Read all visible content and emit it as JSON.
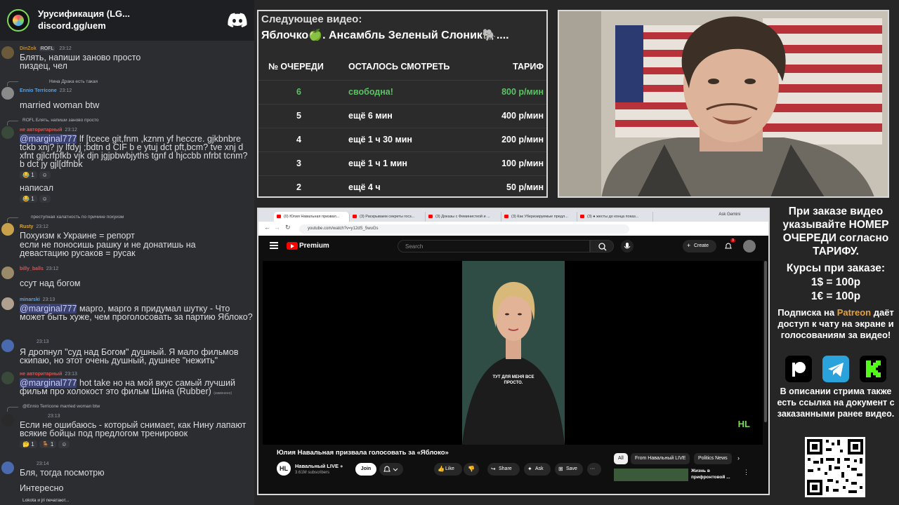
{
  "chat": {
    "server_title": "Урусификация (LG...",
    "server_invite": "discord.gg/uem",
    "messages": [
      {
        "user": "DinZok",
        "tag": "ROFL",
        "time": "23:12",
        "user_color": "#b98b3a",
        "text": "Блять, напиши заново просто\nпиздец, чел"
      },
      {
        "reply": "Нина Драка есть такая",
        "user": "Ennio Terricone",
        "time": "23:12",
        "user_color": "#5aa0e6",
        "text": "married woman btw"
      },
      {
        "reply": "ROFL  Блять, напиши заново просто",
        "user": "не авторитарный",
        "time": "23:12",
        "user_color": "#e05050",
        "mention": "@marginal777",
        "text": " lf [tcece git,fnm ,kznm yf heccre. gjkbnbre tckb xnj? jy lfdyj ;bdtn d CIF b e ytuj dct pft,bcm? tve xnj d xfnt gjlcrfpfkb vjk djn jgjpbwbjyths tgnf d hjccbb nfrbt tcnm? b dct jy gjl[dfnbk",
        "reactions": [
          "1",
          ""
        ]
      },
      {
        "text": "написал",
        "reactions": [
          "1",
          ""
        ]
      },
      {
        "reply": "преступная халатность по причине похуизм",
        "user": "Rusty",
        "time": "23:12",
        "user_color": "#d8a53a",
        "text": "Похуизм к Украине = репорт\nесли не поносишь рашку и не донатишь на\nдевастацию русаков = русак"
      },
      {
        "user": "billy_balls",
        "time": "23:12",
        "user_color": "#e05050",
        "text": "ссут над богом"
      },
      {
        "user": "minarski",
        "time": "23:13",
        "user_color": "#5aa0e6",
        "mention": "@marginal777",
        "text": " марго, марго я придумал шутку - Что может быть хуже, чем проголосовать за партию Яблоко?"
      },
      {
        "time": "23:13",
        "text": "Я дропнул \"суд над Богом\" душный. Я мало фильмов скипаю, но этот очень душный, душнее \"нежить\""
      },
      {
        "user": "не авторитарный",
        "time": "23:13",
        "user_color": "#e05050",
        "mention": "@marginal777",
        "text": " hot take но на мой вкус самый лучший фильм про холокост это фильм Шина (Rubber)",
        "edited": "(изменено)"
      },
      {
        "reply": "@Ennio Terricone  married woman btw",
        "time": "23:13",
        "text": "Если не ошибаюсь - который снимает, как Нину лапают всякие бойцы под предлогом тренировок",
        "reactions": [
          "1",
          "1",
          ""
        ]
      },
      {
        "time": "23:14",
        "text": "Бля, тогда посмотрю"
      },
      {
        "text": "Интересно"
      }
    ],
    "typing": "Lokota и jri печатают..."
  },
  "queue": {
    "next_label": "Следующее видео:",
    "next_title": "Яблочко🍏. Ансамбль Зеленый Слоник🐘....",
    "headers": [
      "№ ОЧЕРЕДИ",
      "ОСТАЛОСЬ СМОТРЕТЬ",
      "ТАРИФ"
    ],
    "rows": [
      {
        "num": "6",
        "left": "свободна!",
        "rate": "800 р/мин",
        "free": true
      },
      {
        "num": "5",
        "left": "ещё 6 мин",
        "rate": "400 р/мин"
      },
      {
        "num": "4",
        "left": "ещё 1 ч 30 мин",
        "rate": "200 р/мин"
      },
      {
        "num": "3",
        "left": "ещё 1 ч 1 мин",
        "rate": "100 р/мин"
      },
      {
        "num": "2",
        "left": "ещё 4 ч",
        "rate": "50 р/мин"
      }
    ]
  },
  "browser": {
    "tabs": [
      "(0) Юлия Навальная призвал...",
      "(3) Раскрываем секреты госз...",
      "(3) Доказы с Феминисткой и ...",
      "(3) Как Уберизируемые предл...",
      "(3) ● жесты до конца показ..."
    ],
    "ask_gemini": "Ask Gemini",
    "url": "youtube.com/watch?v=y12dS_5wuGs",
    "brand": "Premium",
    "search_placeholder": "Search",
    "create": "Create",
    "bell_count": "3",
    "video_caption": "ТУТ ДЛЯ МЕНЯ ВСЕ ПРОСТО.",
    "corner_logo": "HL",
    "video_title": "Юлия Навальная призвала голосовать за «Яблоко»",
    "channel_logo": "HL",
    "channel": "Навальный LIVE",
    "subs": "3.61M subscribers",
    "join": "Join",
    "actions": [
      "Like",
      "",
      "Share",
      "Ask",
      "Save",
      "···"
    ],
    "chips": [
      "All",
      "From Навальный LIVE",
      "Politics News"
    ],
    "side_title": "Жизнь в прифронтовой ..."
  },
  "info": {
    "order_text": "При заказе видео указывайте НОМЕР ОЧЕРЕДИ согласно ТАРИФУ.",
    "rates_title": "Курсы при заказе:",
    "rates": [
      "1$ = 100р",
      "1€ = 100р"
    ],
    "sub_before": "Подписка на ",
    "sub_patreon": "Patreon",
    "sub_after": " даёт доступ к чату на экране и голосованиям за видео!",
    "desc": "В описании стрима также есть ссылка на документ с заказанными ранее видео.",
    "social_icons": [
      "patreon-icon",
      "telegram-icon",
      "kick-icon"
    ]
  }
}
